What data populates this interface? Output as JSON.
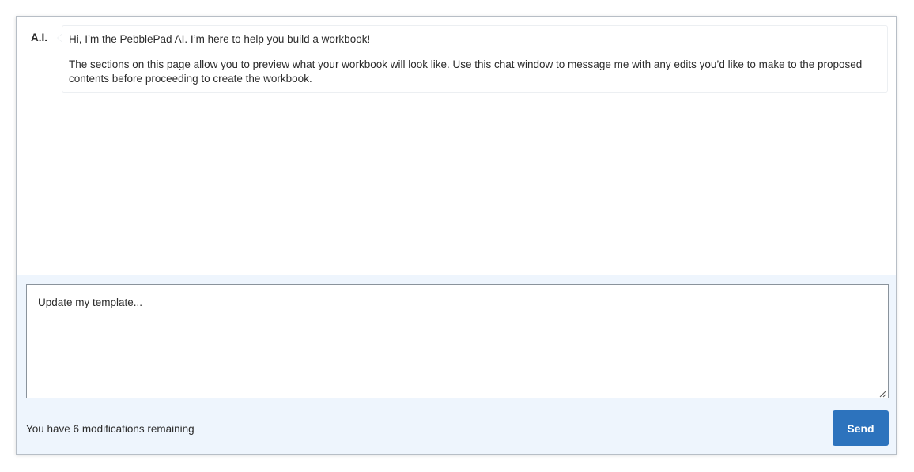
{
  "chat": {
    "messages": [
      {
        "author": "A.I.",
        "paragraphs": [
          "Hi, I’m the PebblePad AI. I’m here to help you build a workbook!",
          "The sections on this page allow you to preview what your workbook will look like. Use this chat window to message me with any edits you’d like to make to the proposed contents before proceeding to create the workbook."
        ]
      }
    ]
  },
  "composer": {
    "placeholder": "Update my template...",
    "value": "",
    "remaining_text": "You have 6 modifications remaining",
    "send_label": "Send"
  },
  "colors": {
    "accent": "#2d73bd",
    "composer_bg": "#eef5fd",
    "border": "#b7bec6"
  }
}
